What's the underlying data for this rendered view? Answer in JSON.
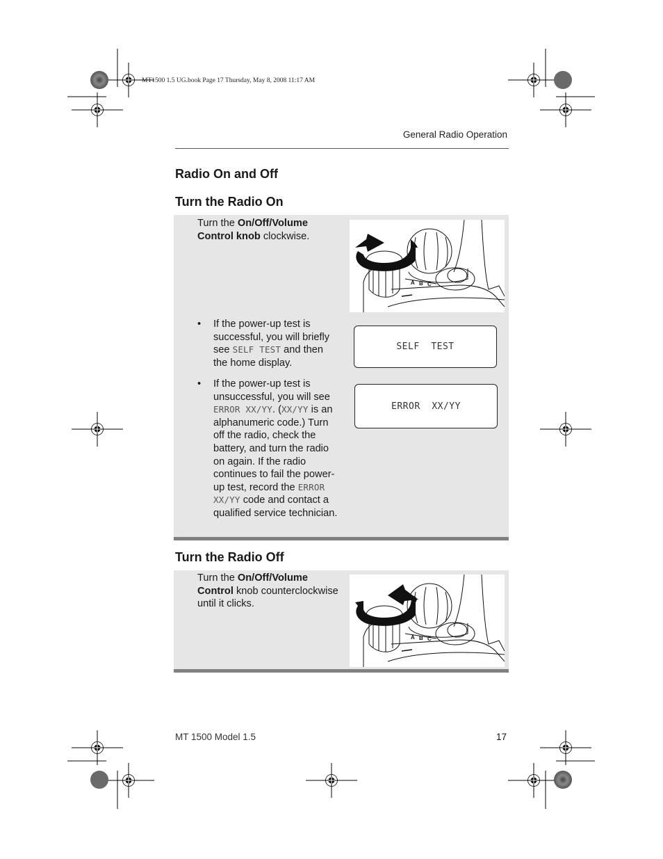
{
  "print_slug": "MT1500 1.5 UG.book  Page 17  Thursday, May 8, 2008  11:17 AM",
  "running_head": "General Radio Operation",
  "section_title": "Radio On and Off",
  "turn_on": {
    "heading": "Turn the Radio On",
    "instruction": {
      "prefix": "Turn the ",
      "bold": "On/Off/Volume Control knob",
      "suffix": " clockwise."
    },
    "illustration_icon": "knob-clockwise-icon",
    "bullets": [
      {
        "marker": "•",
        "parts": [
          {
            "t": "If the power-up test is successful, you will briefly see "
          },
          {
            "t": "SELF  TEST",
            "lcd": true
          },
          {
            "t": " and then the home display."
          }
        ],
        "display": "SELF  TEST"
      },
      {
        "marker": "•",
        "parts": [
          {
            "t": "If the power-up test is unsuccessful, you will see "
          },
          {
            "t": "ERROR  XX/YY",
            "lcd": true
          },
          {
            "t": ". ("
          },
          {
            "t": "XX/YY",
            "lcd": true
          },
          {
            "t": " is an alphanumeric code.) Turn off the radio, check the battery, and turn the radio on again. If the radio continues to fail the power-up test, record the "
          },
          {
            "t": "ERROR  XX/YY",
            "lcd": true
          },
          {
            "t": " code and contact a qualified service technician."
          }
        ],
        "display": "ERROR  XX/YY"
      }
    ]
  },
  "turn_off": {
    "heading": "Turn the Radio Off",
    "instruction": {
      "prefix": "Turn the ",
      "bold": "On/Off/Volume Control",
      "suffix": " knob counterclockwise until it clicks."
    },
    "illustration_icon": "knob-counterclockwise-icon"
  },
  "footer": {
    "model": "MT 1500 Model 1.5",
    "page_number": "17"
  }
}
